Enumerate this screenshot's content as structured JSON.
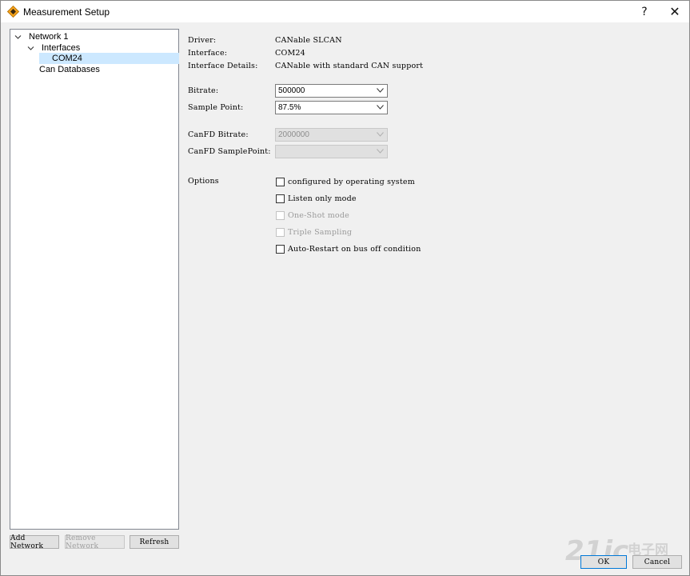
{
  "window": {
    "title": "Measurement Setup",
    "help_glyph": "?",
    "close_glyph": "✕"
  },
  "tree": {
    "network": "Network 1",
    "interfaces": "Interfaces",
    "selected_interface": "COM24",
    "databases": "Can Databases"
  },
  "details": {
    "driver_label": "Driver:",
    "driver_value": "CANable SLCAN",
    "interface_label": "Interface:",
    "interface_value": "COM24",
    "interface_details_label": "Interface Details:",
    "interface_details_value": "CANable with standard CAN support"
  },
  "settings": {
    "bitrate_label": "Bitrate:",
    "bitrate_value": "500000",
    "sample_point_label": "Sample Point:",
    "sample_point_value": "87.5%",
    "canfd_bitrate_label": "CanFD Bitrate:",
    "canfd_bitrate_value": "2000000",
    "canfd_sample_point_label": "CanFD SamplePoint:",
    "canfd_sample_point_value": ""
  },
  "options": {
    "label": "Options",
    "items": [
      {
        "label": "configured by operating system",
        "checked": false,
        "enabled": true
      },
      {
        "label": "Listen only mode",
        "checked": false,
        "enabled": true
      },
      {
        "label": "One-Shot mode",
        "checked": false,
        "enabled": false
      },
      {
        "label": "Triple Sampling",
        "checked": false,
        "enabled": false
      },
      {
        "label": "Auto-Restart on bus off condition",
        "checked": false,
        "enabled": true
      }
    ]
  },
  "buttons": {
    "add_network": "Add Network",
    "remove_network": "Remove Network",
    "refresh": "Refresh",
    "ok": "OK",
    "cancel": "Cancel"
  },
  "watermark": {
    "number": "21ic",
    "cn": "电子网"
  },
  "colors": {
    "accent": "#0078d7",
    "selection": "#cce8ff",
    "icon_orange": "#f5a21b"
  }
}
